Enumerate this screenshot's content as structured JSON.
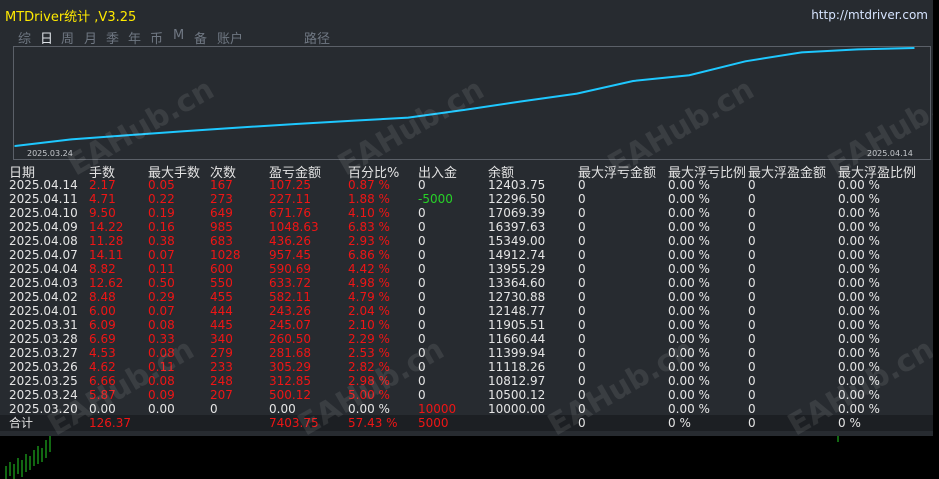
{
  "window": {
    "title": "MTDriver统计 ,V3.25",
    "url": "http://mtdriver.com"
  },
  "tabs": [
    {
      "label": "综",
      "active": false
    },
    {
      "label": "日",
      "active": true
    },
    {
      "label": "周",
      "active": false
    },
    {
      "label": "月",
      "active": false
    },
    {
      "label": "季",
      "active": false
    },
    {
      "label": "年",
      "active": false
    },
    {
      "label": "币",
      "active": false
    },
    {
      "label": "M",
      "active": false
    },
    {
      "label": "备",
      "active": false
    },
    {
      "label": "账户",
      "active": false
    },
    {
      "label": "路径",
      "active": false
    }
  ],
  "chart_data": {
    "type": "line",
    "x_start_label": "2025.03.24",
    "x_end_label": "2025.04.14",
    "x": [
      "2025.03.20",
      "2025.03.24",
      "2025.03.25",
      "2025.03.26",
      "2025.03.27",
      "2025.03.28",
      "2025.03.31",
      "2025.04.01",
      "2025.04.02",
      "2025.04.03",
      "2025.04.04",
      "2025.04.07",
      "2025.04.08",
      "2025.04.09",
      "2025.04.10",
      "2025.04.11",
      "2025.04.14"
    ],
    "values": [
      10000.0,
      10500.12,
      10812.97,
      11118.26,
      11399.94,
      11660.44,
      11905.51,
      12148.77,
      12730.88,
      13364.6,
      13955.29,
      14912.74,
      15349.0,
      16397.63,
      17069.39,
      17296.5,
      17403.75
    ],
    "line_color": "#1ec8ff"
  },
  "table": {
    "headers": [
      "日期",
      "手数",
      "最大手数",
      "次数",
      "盈亏金额",
      "百分比%",
      "出入金",
      "余额",
      "最大浮亏金额",
      "最大浮亏比例",
      "最大浮盈金额",
      "最大浮盈比例"
    ],
    "rows": [
      {
        "date": "2025.04.14",
        "lots": "2.17",
        "max_lots": "0.05",
        "count": "167",
        "pnl": "107.25",
        "pct": "0.87 %",
        "flow": "0",
        "balance": "12403.75",
        "max_dd_amt": "0",
        "max_dd_pct": "0.00 %",
        "max_fp_amt": "0",
        "max_fp_pct": "0.00 %",
        "flow_color": "w"
      },
      {
        "date": "2025.04.11",
        "lots": "4.71",
        "max_lots": "0.22",
        "count": "273",
        "pnl": "227.11",
        "pct": "1.88 %",
        "flow": "-5000",
        "balance": "12296.50",
        "max_dd_amt": "0",
        "max_dd_pct": "0.00 %",
        "max_fp_amt": "0",
        "max_fp_pct": "0.00 %",
        "flow_color": "g"
      },
      {
        "date": "2025.04.10",
        "lots": "9.50",
        "max_lots": "0.19",
        "count": "649",
        "pnl": "671.76",
        "pct": "4.10 %",
        "flow": "0",
        "balance": "17069.39",
        "max_dd_amt": "0",
        "max_dd_pct": "0.00 %",
        "max_fp_amt": "0",
        "max_fp_pct": "0.00 %",
        "flow_color": "w"
      },
      {
        "date": "2025.04.09",
        "lots": "14.22",
        "max_lots": "0.16",
        "count": "985",
        "pnl": "1048.63",
        "pct": "6.83 %",
        "flow": "0",
        "balance": "16397.63",
        "max_dd_amt": "0",
        "max_dd_pct": "0.00 %",
        "max_fp_amt": "0",
        "max_fp_pct": "0.00 %",
        "flow_color": "w"
      },
      {
        "date": "2025.04.08",
        "lots": "11.28",
        "max_lots": "0.38",
        "count": "683",
        "pnl": "436.26",
        "pct": "2.93 %",
        "flow": "0",
        "balance": "15349.00",
        "max_dd_amt": "0",
        "max_dd_pct": "0.00 %",
        "max_fp_amt": "0",
        "max_fp_pct": "0.00 %",
        "flow_color": "w"
      },
      {
        "date": "2025.04.07",
        "lots": "14.11",
        "max_lots": "0.07",
        "count": "1028",
        "pnl": "957.45",
        "pct": "6.86 %",
        "flow": "0",
        "balance": "14912.74",
        "max_dd_amt": "0",
        "max_dd_pct": "0.00 %",
        "max_fp_amt": "0",
        "max_fp_pct": "0.00 %",
        "flow_color": "w"
      },
      {
        "date": "2025.04.04",
        "lots": "8.82",
        "max_lots": "0.11",
        "count": "600",
        "pnl": "590.69",
        "pct": "4.42 %",
        "flow": "0",
        "balance": "13955.29",
        "max_dd_amt": "0",
        "max_dd_pct": "0.00 %",
        "max_fp_amt": "0",
        "max_fp_pct": "0.00 %",
        "flow_color": "w"
      },
      {
        "date": "2025.04.03",
        "lots": "12.62",
        "max_lots": "0.50",
        "count": "550",
        "pnl": "633.72",
        "pct": "4.98 %",
        "flow": "0",
        "balance": "13364.60",
        "max_dd_amt": "0",
        "max_dd_pct": "0.00 %",
        "max_fp_amt": "0",
        "max_fp_pct": "0.00 %",
        "flow_color": "w"
      },
      {
        "date": "2025.04.02",
        "lots": "8.48",
        "max_lots": "0.29",
        "count": "455",
        "pnl": "582.11",
        "pct": "4.79 %",
        "flow": "0",
        "balance": "12730.88",
        "max_dd_amt": "0",
        "max_dd_pct": "0.00 %",
        "max_fp_amt": "0",
        "max_fp_pct": "0.00 %",
        "flow_color": "w"
      },
      {
        "date": "2025.04.01",
        "lots": "6.00",
        "max_lots": "0.07",
        "count": "444",
        "pnl": "243.26",
        "pct": "2.04 %",
        "flow": "0",
        "balance": "12148.77",
        "max_dd_amt": "0",
        "max_dd_pct": "0.00 %",
        "max_fp_amt": "0",
        "max_fp_pct": "0.00 %",
        "flow_color": "w"
      },
      {
        "date": "2025.03.31",
        "lots": "6.09",
        "max_lots": "0.08",
        "count": "445",
        "pnl": "245.07",
        "pct": "2.10 %",
        "flow": "0",
        "balance": "11905.51",
        "max_dd_amt": "0",
        "max_dd_pct": "0.00 %",
        "max_fp_amt": "0",
        "max_fp_pct": "0.00 %",
        "flow_color": "w"
      },
      {
        "date": "2025.03.28",
        "lots": "6.69",
        "max_lots": "0.33",
        "count": "340",
        "pnl": "260.50",
        "pct": "2.29 %",
        "flow": "0",
        "balance": "11660.44",
        "max_dd_amt": "0",
        "max_dd_pct": "0.00 %",
        "max_fp_amt": "0",
        "max_fp_pct": "0.00 %",
        "flow_color": "w"
      },
      {
        "date": "2025.03.27",
        "lots": "4.53",
        "max_lots": "0.08",
        "count": "279",
        "pnl": "281.68",
        "pct": "2.53 %",
        "flow": "0",
        "balance": "11399.94",
        "max_dd_amt": "0",
        "max_dd_pct": "0.00 %",
        "max_fp_amt": "0",
        "max_fp_pct": "0.00 %",
        "flow_color": "w"
      },
      {
        "date": "2025.03.26",
        "lots": "4.62",
        "max_lots": "0.11",
        "count": "233",
        "pnl": "305.29",
        "pct": "2.82 %",
        "flow": "0",
        "balance": "11118.26",
        "max_dd_amt": "0",
        "max_dd_pct": "0.00 %",
        "max_fp_amt": "0",
        "max_fp_pct": "0.00 %",
        "flow_color": "w"
      },
      {
        "date": "2025.03.25",
        "lots": "6.66",
        "max_lots": "0.08",
        "count": "248",
        "pnl": "312.85",
        "pct": "2.98 %",
        "flow": "0",
        "balance": "10812.97",
        "max_dd_amt": "0",
        "max_dd_pct": "0.00 %",
        "max_fp_amt": "0",
        "max_fp_pct": "0.00 %",
        "flow_color": "w"
      },
      {
        "date": "2025.03.24",
        "lots": "5.87",
        "max_lots": "0.09",
        "count": "207",
        "pnl": "500.12",
        "pct": "5.00 %",
        "flow": "0",
        "balance": "10500.12",
        "max_dd_amt": "0",
        "max_dd_pct": "0.00 %",
        "max_fp_amt": "0",
        "max_fp_pct": "0.00 %",
        "flow_color": "w"
      },
      {
        "date": "2025.03.20",
        "lots": "0.00",
        "max_lots": "0.00",
        "count": "0",
        "pnl": "0.00",
        "pct": "0.00 %",
        "flow": "10000",
        "balance": "10000.00",
        "max_dd_amt": "0",
        "max_dd_pct": "0.00 %",
        "max_fp_amt": "0",
        "max_fp_pct": "0.00 %",
        "flow_color": "r",
        "neutral": true
      }
    ],
    "totals": {
      "label": "合计",
      "lots": "126.37",
      "pnl": "7403.75",
      "pct": "57.43 %",
      "flow": "5000",
      "max_dd_amt": "0",
      "max_dd_pct": "0 %",
      "max_fp_amt": "0",
      "max_fp_pct": "0 %"
    }
  },
  "watermark": "EAHub.cn",
  "colors": {
    "panel_bg": "#272b30",
    "title": "#ffea00",
    "loss_profit_red": "#ef1515",
    "withdraw_green": "#27d227",
    "curve": "#1ec8ff"
  }
}
